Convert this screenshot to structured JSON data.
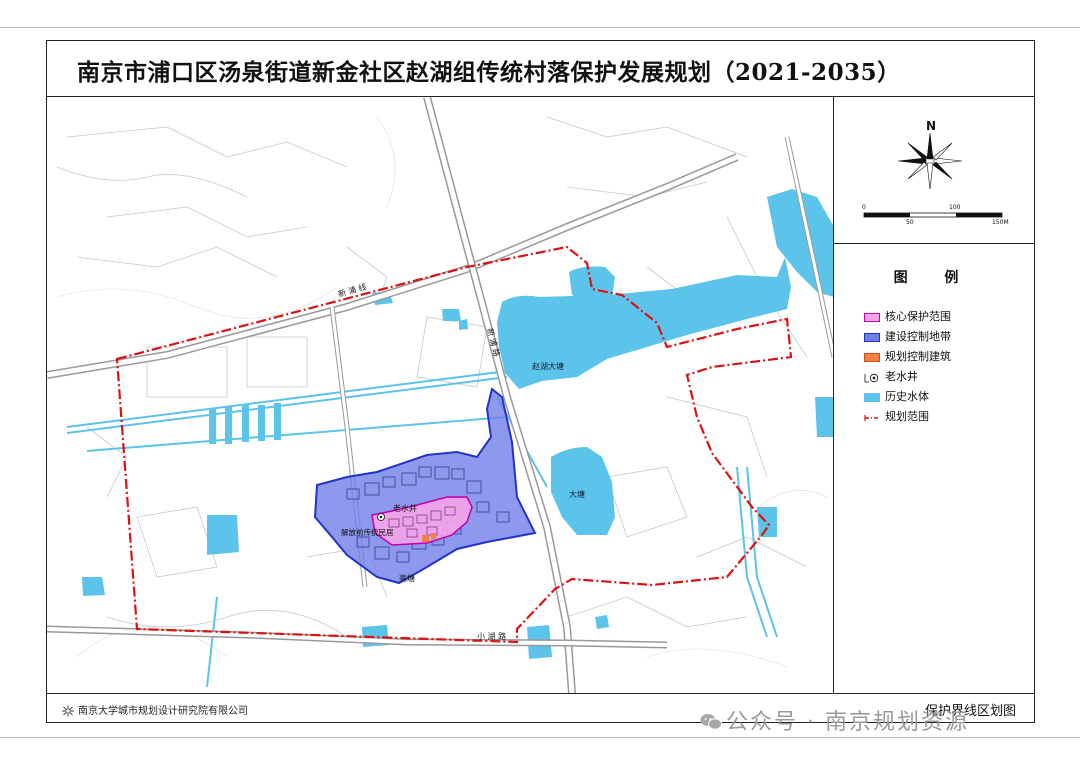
{
  "title": "南京市浦口区汤泉街道新金社区赵湖组传统村落保护发展规划（2021-2035）",
  "map": {
    "road_labels": [
      "新 浦 线",
      "新 浦 路",
      "小 湖 路"
    ],
    "water_labels": [
      "赵湖大塘",
      "大塘"
    ],
    "place_labels": [
      "老水井",
      "解放前传统民居",
      "亮塘"
    ]
  },
  "compass": {
    "north": "N",
    "scale_ticks": [
      "0",
      "50",
      "100",
      "150M"
    ]
  },
  "legend": {
    "title": "图  例",
    "items": [
      {
        "label": "核心保护范围",
        "color": "#f5a3e8",
        "border": "#c000a8"
      },
      {
        "label": "建设控制地带",
        "color": "#6f7fe8",
        "border": "#2233cc"
      },
      {
        "label": "规划控制建筑",
        "color": "#f08048",
        "border": "#d05010"
      },
      {
        "label": "老水井",
        "icon": "well-icon"
      },
      {
        "label": "历史水体",
        "color": "#5cc3ea",
        "border": "#5cc3ea"
      },
      {
        "label": "规划范围",
        "icon": "boundary-line-icon",
        "color": "#dd1111"
      }
    ]
  },
  "footer": {
    "institution": "南京大学城市规划设计研究院有限公司",
    "map_name": "保护界线区划图"
  },
  "watermark": "公众号 · 南京规划资源"
}
